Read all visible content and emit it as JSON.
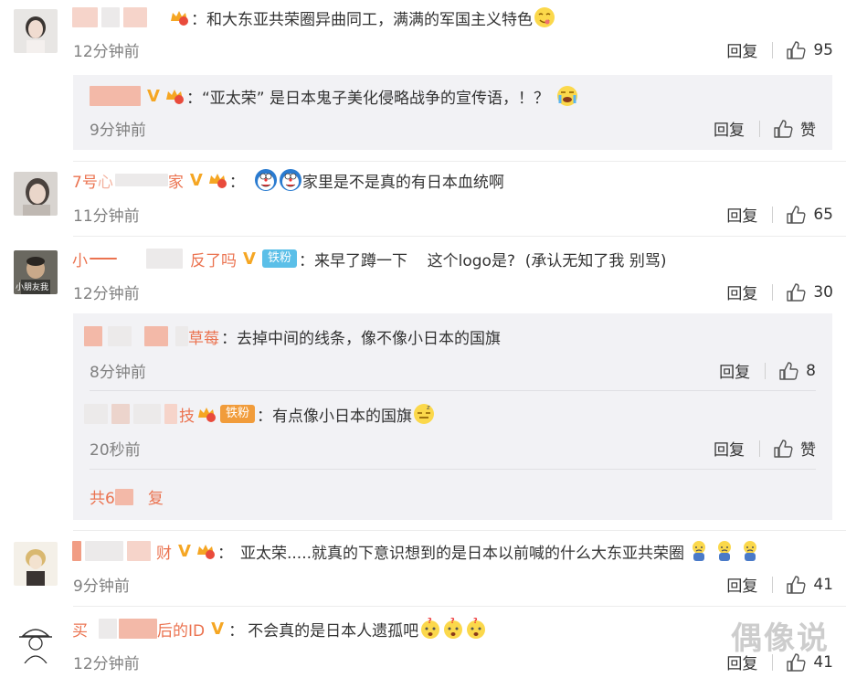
{
  "comments": [
    {
      "id": "c1",
      "text": "和大东亚共荣圈异曲同工，满满的军国主义特色",
      "time": "12分钟前",
      "reply_label": "回复",
      "likes": "95",
      "replies": [
        {
          "text": "“亚太荣” 是日本鬼子美化侵略战争的宣传语，！？",
          "time": "9分钟前",
          "reply_label": "回复",
          "like_label": "赞"
        }
      ]
    },
    {
      "id": "c2",
      "name_start": "7号",
      "name_end": "家",
      "text": "家里是不是真的有日本血统啊",
      "time": "11分钟前",
      "reply_label": "回复",
      "likes": "65"
    },
    {
      "id": "c3",
      "name_start": "小",
      "name_end": "反了吗",
      "fan_badge": "铁粉",
      "text": "来早了蹲一下    这个logo是?  (承认无知了我 别骂)",
      "avatar_caption": "小朋友我",
      "time": "12分钟前",
      "reply_label": "回复",
      "likes": "30",
      "replies": [
        {
          "name_end": "草莓",
          "text": "去掉中间的线条，像不像小日本的国旗",
          "time": "8分钟前",
          "reply_label": "回复",
          "likes": "8"
        },
        {
          "name_end": "技",
          "fan_badge": "铁粉",
          "text": "有点像小日本的国旗",
          "time": "20秒前",
          "reply_label": "回复",
          "like_label": "赞"
        }
      ],
      "more_prefix": "共6",
      "more_suffix": "复"
    },
    {
      "id": "c4",
      "name_end": "财",
      "text": "亚太荣.....就真的下意识想到的是日本以前喊的什么大东亚共荣圈",
      "time": "9分钟前",
      "reply_label": "回复",
      "likes": "41"
    },
    {
      "id": "c5",
      "name_start": "买",
      "name_end": "后的ID",
      "text": "不会真的是日本人遗孤吧",
      "time": "12分钟前",
      "reply_label": "回复",
      "likes": "41"
    }
  ],
  "watermark": "偶像说",
  "colors": {
    "username": "#eb7350",
    "vip": "#f5a623",
    "fan_badge": "#5bbfe8",
    "subbox_bg": "#f2f2f5",
    "time": "#808080"
  }
}
